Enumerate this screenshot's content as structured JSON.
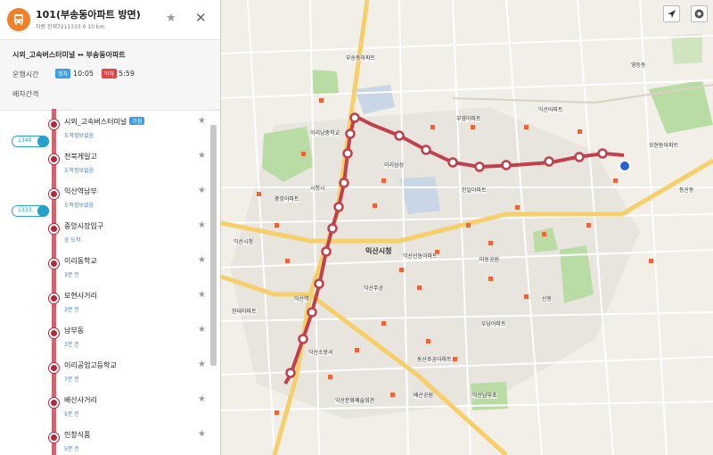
{
  "route": {
    "title": "101(부송동아파트 방면)",
    "subtitle": "차량 전체7211333 0 10 km",
    "favorite_icon": "star-icon",
    "close_icon": "close-icon"
  },
  "info": {
    "direction": "시외_고속버스터미널 ↔ 부송동아파트",
    "hours_label": "운행시간",
    "first_badge": "첫차",
    "first_time": "10:05",
    "last_badge": "막차",
    "last_time": "5:59",
    "interval_label": "배차간격"
  },
  "stops": [
    {
      "name": "시외_고속버스터미널",
      "sub": "도착정보없음",
      "tag": "기점"
    },
    {
      "name": "전북게일고",
      "sub": "도착정보없음",
      "tag": ""
    },
    {
      "name": "익산역남부",
      "sub": "도착정보없음",
      "tag": ""
    },
    {
      "name": "중앙시장입구",
      "sub": "곧 도착",
      "tag": ""
    },
    {
      "name": "이리동학교",
      "sub": "3분 전",
      "tag": ""
    },
    {
      "name": "모현사거리",
      "sub": "3분 전",
      "tag": ""
    },
    {
      "name": "남부동",
      "sub": "3분 전",
      "tag": ""
    },
    {
      "name": "이리공업고등학교",
      "sub": "7분 전",
      "tag": ""
    },
    {
      "name": "배산사거리",
      "sub": "5분 전",
      "tag": ""
    },
    {
      "name": "인창식품",
      "sub": "5분 전",
      "tag": ""
    }
  ],
  "buses": [
    {
      "number": "1340"
    },
    {
      "number": "1333"
    }
  ],
  "map": {
    "labels": [
      {
        "text": "부송동아파트"
      },
      {
        "text": "이리남중학교"
      },
      {
        "text": "이리삼성"
      },
      {
        "text": "시청시"
      },
      {
        "text": "익산시청"
      },
      {
        "text": "익산신동아파트"
      },
      {
        "text": "부영아파트"
      },
      {
        "text": "중앙아파트"
      },
      {
        "text": "익산아파트"
      },
      {
        "text": "영등동"
      },
      {
        "text": "모현동아파트"
      },
      {
        "text": "동산동"
      },
      {
        "text": "마동공원"
      },
      {
        "text": "현대아파트"
      },
      {
        "text": "동산주공아파트"
      },
      {
        "text": "익산문화예술회관"
      },
      {
        "text": "익산역"
      },
      {
        "text": "배산공원"
      },
      {
        "text": "우남아파트"
      },
      {
        "text": "익산주공"
      },
      {
        "text": "한일아파트"
      },
      {
        "text": "익산남부초"
      },
      {
        "text": "익산소방서"
      },
      {
        "text": "신동"
      }
    ],
    "city_hall_label": "익산시청",
    "locate_icon": "navigation-arrow-icon",
    "layers_icon": "layers-icon"
  },
  "colors": {
    "route": "#c2404c",
    "accent": "#f0802a",
    "link": "#3a9ee8",
    "bus_badge": "#27a0cc",
    "road_major": "#f6cf6a"
  }
}
